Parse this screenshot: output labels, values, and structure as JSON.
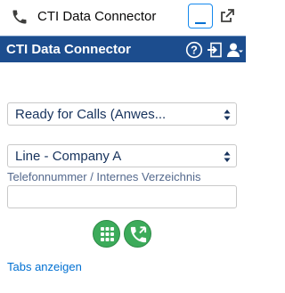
{
  "utility_bar": {
    "title": "CTI Data Connector",
    "icons": [
      "phone-icon",
      "minimize-icon",
      "popout-icon"
    ]
  },
  "header": {
    "title": "CTI Data Connector",
    "icons": [
      "help-icon",
      "logout-icon",
      "user-icon"
    ]
  },
  "status_select": {
    "value": "Ready for Calls (Anwes..."
  },
  "line_select": {
    "value": "Line - Company A"
  },
  "phone_field": {
    "label": "Telefonnummer / Internes Verzeichnis",
    "value": ""
  },
  "actions": {
    "dialpad_icon": "dialpad-icon",
    "call_icon": "phone-call-icon"
  },
  "footer": {
    "tabs_link": "Tabs anzeigen"
  },
  "colors": {
    "header_bg": "#1c4d8e",
    "button_green": "#3cab5a",
    "link_blue": "#0070d2"
  }
}
